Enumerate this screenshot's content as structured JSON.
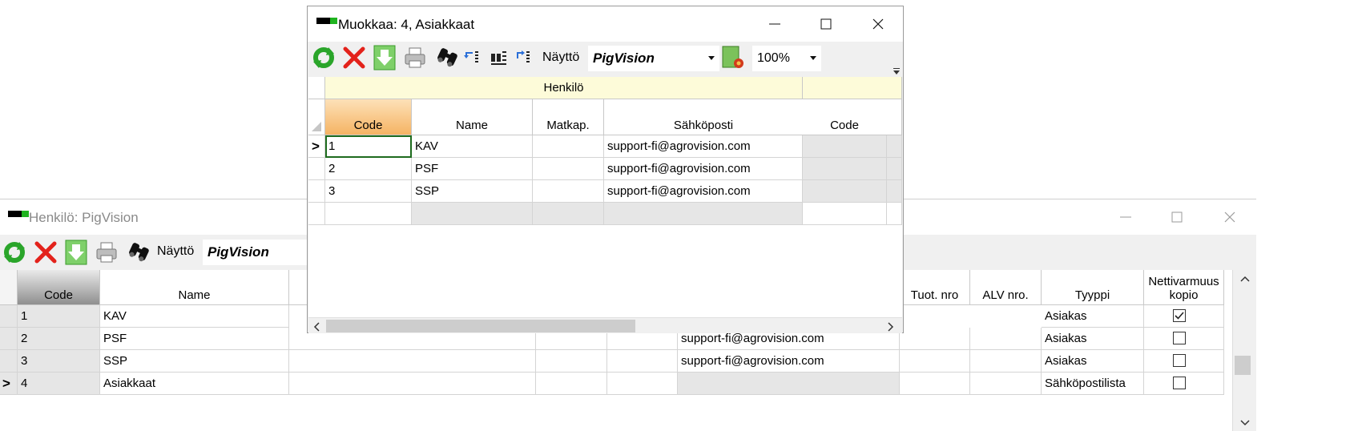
{
  "back_window": {
    "title": "Henkilö: PigVision",
    "toolbar": {
      "view_label": "Näyttö",
      "view_value": "PigVision"
    },
    "columns": {
      "code": "Code",
      "name": "Name",
      "tuot_nro": "Tuot. nro",
      "alv_nro": "ALV nro.",
      "tyyppi": "Tyyppi",
      "nettivarmuus": "Nettivarmuus",
      "nettivarmuus2": "kopio"
    },
    "rows": [
      {
        "code": "1",
        "name": "KAV",
        "email": "",
        "tyyppi": "Asiakas",
        "checked": true
      },
      {
        "code": "2",
        "name": "PSF",
        "email": "support-fi@agrovision.com",
        "tyyppi": "Asiakas",
        "checked": false
      },
      {
        "code": "3",
        "name": "SSP",
        "email": "support-fi@agrovision.com",
        "tyyppi": "Asiakas",
        "checked": false
      },
      {
        "code": "4",
        "name": "Asiakkaat",
        "email": "",
        "tyyppi": "Sähköpostilista",
        "checked": false
      }
    ],
    "current_row_marker": ">"
  },
  "front_window": {
    "title": "Muokkaa: 4, Asiakkaat",
    "toolbar": {
      "view_label": "Näyttö",
      "view_value": "PigVision",
      "zoom": "100%"
    },
    "group_header": "Henkilö",
    "columns": {
      "code": "Code",
      "name": "Name",
      "matkap": "Matkap.",
      "email": "Sähköposti",
      "code2": "Code"
    },
    "rows": [
      {
        "code": "1",
        "name": "KAV",
        "matkap": "",
        "email": "support-fi@agrovision.com"
      },
      {
        "code": "2",
        "name": "PSF",
        "matkap": "",
        "email": "support-fi@agrovision.com"
      },
      {
        "code": "3",
        "name": "SSP",
        "matkap": "",
        "email": "support-fi@agrovision.com"
      }
    ],
    "current_row_marker": ">"
  },
  "colors": {
    "accent_green": "#1fb31f",
    "header_orange": "#f5b363",
    "group_yellow": "#fdfbd9",
    "current_cell_border": "#1e6b1e"
  }
}
